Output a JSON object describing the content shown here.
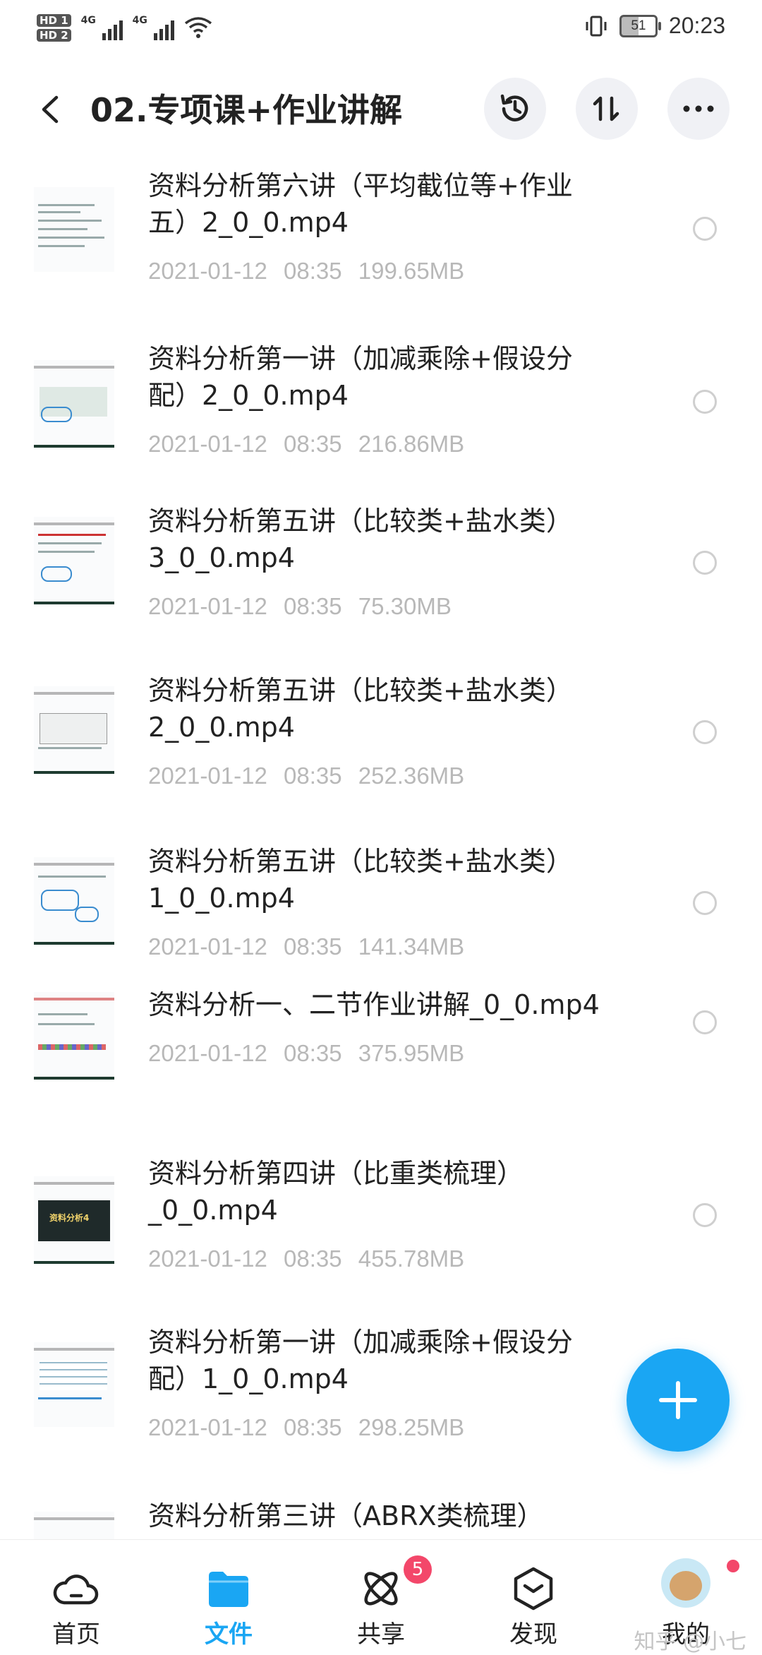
{
  "status_bar": {
    "hd1": "HD 1",
    "hd2": "HD 2",
    "sig1": "4G",
    "sig2": "4G",
    "battery": "51",
    "time": "20:23"
  },
  "header": {
    "title": "02.专项课+作业讲解"
  },
  "files": [
    {
      "line1": "资料分析第六讲（平均截位等+作业",
      "line2": "五）2_0_0.mp4",
      "date": "2021-01-12",
      "time": "08:35",
      "size": "199.65MB"
    },
    {
      "line1": "资料分析第一讲（加减乘除+假设分",
      "line2": "配）2_0_0.mp4",
      "date": "2021-01-12",
      "time": "08:35",
      "size": "216.86MB"
    },
    {
      "line1": "资料分析第五讲（比较类+盐水类）",
      "line2": "3_0_0.mp4",
      "date": "2021-01-12",
      "time": "08:35",
      "size": "75.30MB"
    },
    {
      "line1": "资料分析第五讲（比较类+盐水类）",
      "line2": "2_0_0.mp4",
      "date": "2021-01-12",
      "time": "08:35",
      "size": "252.36MB"
    },
    {
      "line1": "资料分析第五讲（比较类+盐水类）",
      "line2": "1_0_0.mp4",
      "date": "2021-01-12",
      "time": "08:35",
      "size": "141.34MB"
    },
    {
      "line1": "资料分析一、二节作业讲解_0_0.mp4",
      "line2": "",
      "date": "2021-01-12",
      "time": "08:35",
      "size": "375.95MB"
    },
    {
      "line1": "资料分析第四讲（比重类梳理）",
      "line2": "_0_0.mp4",
      "date": "2021-01-12",
      "time": "08:35",
      "size": "455.78MB",
      "thumb_text": "资料分析4"
    },
    {
      "line1": "资料分析第一讲（加减乘除+假设分",
      "line2": "配）1_0_0.mp4",
      "date": "2021-01-12",
      "time": "08:35",
      "size": "298.25MB"
    },
    {
      "line1": "资料分析第三讲（ABRX类梳理）",
      "line2": "",
      "date": "",
      "time": "",
      "size": ""
    }
  ],
  "nav": {
    "home": "首页",
    "files": "文件",
    "share": "共享",
    "share_badge": "5",
    "discover": "发现",
    "mine": "我的"
  },
  "watermark": "知乎 @小七",
  "colors": {
    "accent": "#1aa6f3",
    "badge": "#f3476a"
  }
}
